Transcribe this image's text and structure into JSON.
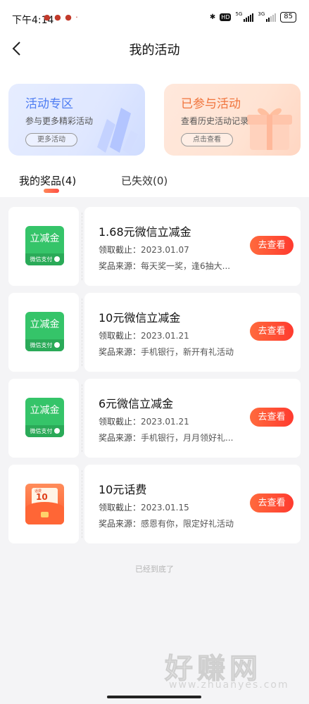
{
  "status_bar": {
    "time": "下午4:14",
    "battery": "85",
    "network_1": "5G",
    "network_2": "3G",
    "hd": "HD"
  },
  "header": {
    "title": "我的活动"
  },
  "promos": [
    {
      "title": "活动专区",
      "subtitle": "参与更多精彩活动",
      "button": "更多活动"
    },
    {
      "title": "已参与活动",
      "subtitle": "查看历史活动记录",
      "button": "点击查看"
    }
  ],
  "tabs": {
    "active": "我的奖品(4)",
    "inactive": "已失效(0)"
  },
  "coupons": [
    {
      "badge_top": "立减金",
      "badge_bottom": "微信支付",
      "title": "1.68元微信立减金",
      "deadline_label": "领取截止：",
      "deadline": "2023.01.07",
      "source_label": "奖品来源：",
      "source": "每天奖一奖，逢6抽大...",
      "button": "去查看"
    },
    {
      "badge_top": "立减金",
      "badge_bottom": "微信支付",
      "title": "10元微信立减金",
      "deadline_label": "领取截止：",
      "deadline": "2023.01.21",
      "source_label": "奖品来源：",
      "source": "手机银行，新开有礼活动",
      "button": "去查看"
    },
    {
      "badge_top": "立减金",
      "badge_bottom": "微信支付",
      "title": "6元微信立减金",
      "deadline_label": "领取截止：",
      "deadline": "2023.01.21",
      "source_label": "奖品来源：",
      "source": "手机银行，月月领好礼...",
      "button": "去查看"
    },
    {
      "envelope_amount": "10",
      "envelope_unit": "话费",
      "title": "10元话费",
      "deadline_label": "领取截止：",
      "deadline": "2023.01.15",
      "source_label": "奖品来源：",
      "source": "感恩有你，限定好礼活动",
      "button": "去查看"
    }
  ],
  "end_note": "已经到底了",
  "watermark": {
    "brand": "好赚网",
    "url": "www.zhuanyes.com"
  },
  "colors": {
    "accent_red": "#ff3b2f",
    "wechat_green": "#35c469",
    "blue_title": "#4d7cf2",
    "orange_title": "#f0743c"
  }
}
